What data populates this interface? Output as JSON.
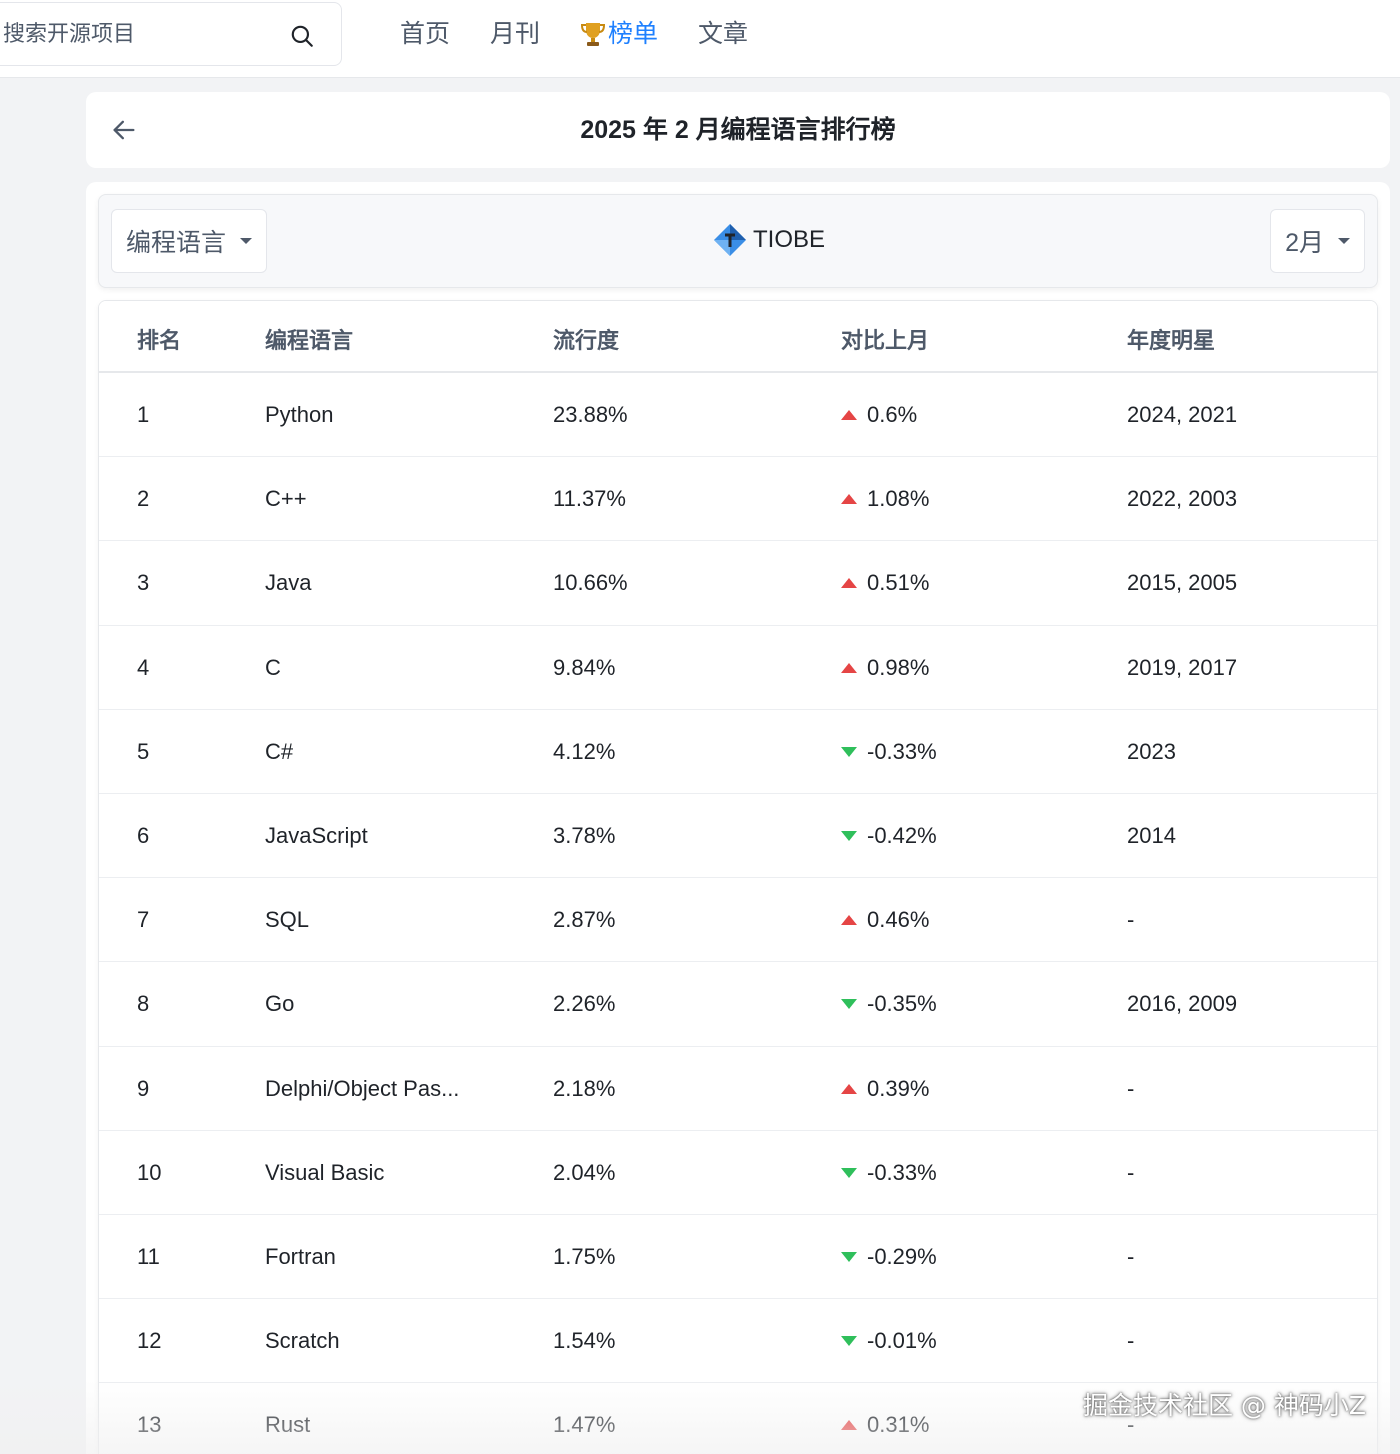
{
  "header": {
    "search": {
      "placeholder": "搜索开源项目",
      "value": ""
    },
    "nav": [
      {
        "label": "首页",
        "active": false
      },
      {
        "label": "月刊",
        "active": false
      },
      {
        "label": "榜单",
        "active": true,
        "icon": "trophy-icon"
      },
      {
        "label": "文章",
        "active": false
      }
    ]
  },
  "page": {
    "title": "2025 年 2 月编程语言排行榜",
    "back_icon": "arrow-left-icon"
  },
  "filters": {
    "category": "编程语言",
    "source": "TIOBE",
    "month": "2月"
  },
  "table": {
    "columns": [
      "排名",
      "编程语言",
      "流行度",
      "对比上月",
      "年度明星"
    ],
    "rows": [
      {
        "rank": "1",
        "language": "Python",
        "popularity": "23.88%",
        "trend": "up",
        "change": "0.6%",
        "award": "2024, 2021"
      },
      {
        "rank": "2",
        "language": "C++",
        "popularity": "11.37%",
        "trend": "up",
        "change": "1.08%",
        "award": "2022, 2003"
      },
      {
        "rank": "3",
        "language": "Java",
        "popularity": "10.66%",
        "trend": "up",
        "change": "0.51%",
        "award": "2015, 2005"
      },
      {
        "rank": "4",
        "language": "C",
        "popularity": "9.84%",
        "trend": "up",
        "change": "0.98%",
        "award": "2019, 2017"
      },
      {
        "rank": "5",
        "language": "C#",
        "popularity": "4.12%",
        "trend": "down",
        "change": "-0.33%",
        "award": "2023"
      },
      {
        "rank": "6",
        "language": "JavaScript",
        "popularity": "3.78%",
        "trend": "down",
        "change": "-0.42%",
        "award": "2014"
      },
      {
        "rank": "7",
        "language": "SQL",
        "popularity": "2.87%",
        "trend": "up",
        "change": "0.46%",
        "award": "-"
      },
      {
        "rank": "8",
        "language": "Go",
        "popularity": "2.26%",
        "trend": "down",
        "change": "-0.35%",
        "award": "2016, 2009"
      },
      {
        "rank": "9",
        "language": "Delphi/Object Pas...",
        "popularity": "2.18%",
        "trend": "up",
        "change": "0.39%",
        "award": "-"
      },
      {
        "rank": "10",
        "language": "Visual Basic",
        "popularity": "2.04%",
        "trend": "down",
        "change": "-0.33%",
        "award": "-"
      },
      {
        "rank": "11",
        "language": "Fortran",
        "popularity": "1.75%",
        "trend": "down",
        "change": "-0.29%",
        "award": "-"
      },
      {
        "rank": "12",
        "language": "Scratch",
        "popularity": "1.54%",
        "trend": "down",
        "change": "-0.01%",
        "award": "-"
      },
      {
        "rank": "13",
        "language": "Rust",
        "popularity": "1.47%",
        "trend": "up",
        "change": "0.31%",
        "award": "-"
      }
    ]
  },
  "colors": {
    "accent": "#1e80ff",
    "up": "#e54545",
    "down": "#2fbf5b"
  },
  "watermark": "掘金技术社区 @ 神码小Z"
}
